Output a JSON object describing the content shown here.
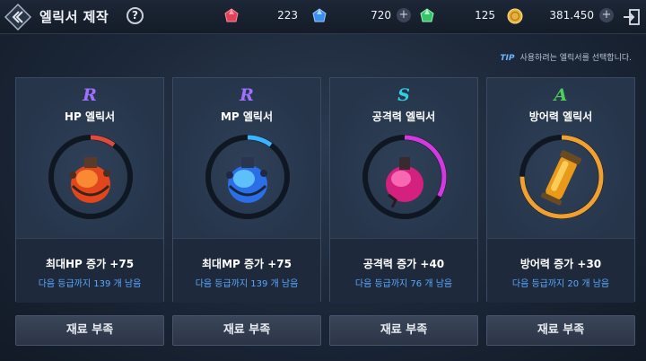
{
  "header": {
    "title": "엘릭서 제작",
    "help_label": "?"
  },
  "resources": [
    {
      "icon": "red-gem-icon",
      "value": "223",
      "color": "#e0425a"
    },
    {
      "icon": "blue-gem-icon",
      "value": "720",
      "color": "#3c8ef0"
    },
    {
      "icon": "green-gem-icon",
      "value": "125",
      "color": "#35c46a"
    },
    {
      "icon": "gold-coin-icon",
      "value": "381.450",
      "color": "#e6b23a"
    }
  ],
  "plus_label": "+",
  "tip": {
    "label": "TIP",
    "text": "사용하려는 엘릭서를 선택합니다."
  },
  "elixirs": [
    {
      "grade": "R",
      "grade_color": "#a070ff",
      "name": "HP 엘릭서",
      "stat": "최대HP 증가 +75",
      "remaining": "다음 등급까지 139 개 남음",
      "progress": 0.1,
      "ring_color": "#e04a3a",
      "button": "재료 부족"
    },
    {
      "grade": "R",
      "grade_color": "#a070ff",
      "name": "MP 엘릭서",
      "stat": "최대MP 증가 +75",
      "remaining": "다음 등급까지 139 개 남음",
      "progress": 0.1,
      "ring_color": "#3ab4ff",
      "button": "재료 부족"
    },
    {
      "grade": "S",
      "grade_color": "#2fd0e0",
      "name": "공격력 엘릭서",
      "stat": "공격력 증가 +40",
      "remaining": "다음 등급까지 76 개 남음",
      "progress": 0.33,
      "ring_color": "#d23ae0",
      "button": "재료 부족"
    },
    {
      "grade": "A",
      "grade_color": "#4cd05a",
      "name": "방어력 엘릭서",
      "stat": "방어력 증가 +30",
      "remaining": "다음 등급까지 20 개 남음",
      "progress": 0.75,
      "ring_color": "#f0a030",
      "button": "재료 부족"
    }
  ]
}
